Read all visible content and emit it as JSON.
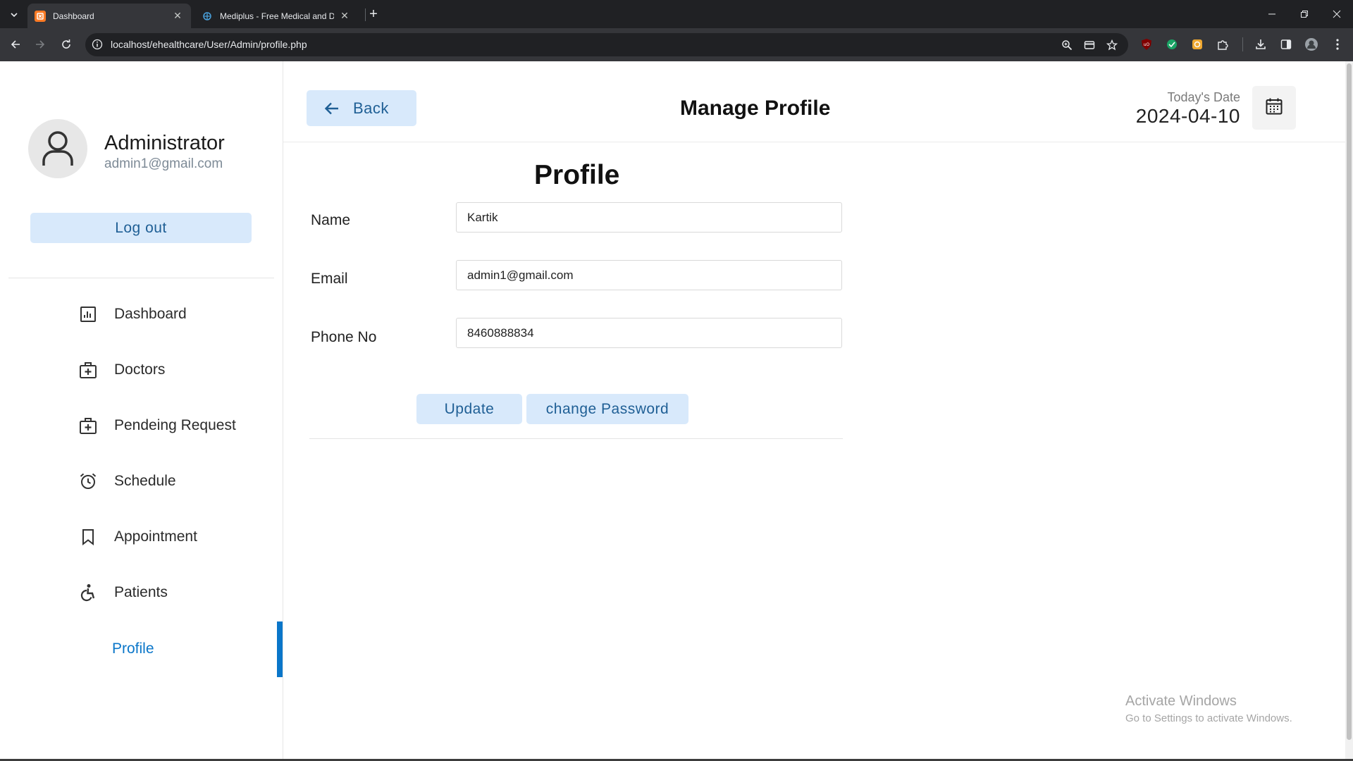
{
  "browser": {
    "tabs": [
      {
        "title": "Dashboard",
        "active": true
      },
      {
        "title": "Mediplus - Free Medical and Do",
        "active": false
      }
    ],
    "url": "localhost/ehealthcare/User/Admin/profile.php",
    "icons": [
      "search-icon",
      "card-icon",
      "star-icon",
      "ublock-icon",
      "extension-icon",
      "puzzle-icon",
      "download-icon",
      "sidepanel-icon",
      "avatar-icon",
      "menu-icon"
    ]
  },
  "sidebar": {
    "user_name": "Administrator",
    "user_email": "admin1@gmail.com",
    "logout_label": "Log out",
    "items": [
      {
        "label": "Dashboard",
        "icon": "dashboard-icon"
      },
      {
        "label": "Doctors",
        "icon": "medical-bag-icon"
      },
      {
        "label": "Pendeing Request",
        "icon": "medical-bag-icon"
      },
      {
        "label": "Schedule",
        "icon": "alarm-clock-icon"
      },
      {
        "label": "Appointment",
        "icon": "bookmark-icon"
      },
      {
        "label": "Patients",
        "icon": "wheelchair-icon"
      },
      {
        "label": "Profile",
        "icon": "",
        "active": true
      }
    ]
  },
  "header": {
    "back_label": "Back",
    "title": "Manage Profile",
    "date_label": "Today's Date",
    "date_value": "2024-04-10"
  },
  "form": {
    "title": "Profile",
    "fields": [
      {
        "label": "Name",
        "value": "Kartik"
      },
      {
        "label": "Email",
        "value": "admin1@gmail.com"
      },
      {
        "label": "Phone No",
        "value": "8460888834"
      }
    ],
    "update_label": "Update",
    "change_password_label": "change Password"
  },
  "watermark": {
    "line1": "Activate Windows",
    "line2": "Go to Settings to activate Windows."
  },
  "colors": {
    "accent": "#0a76c9",
    "button_bg": "#d8e9fb",
    "button_text": "#1f5f95"
  }
}
